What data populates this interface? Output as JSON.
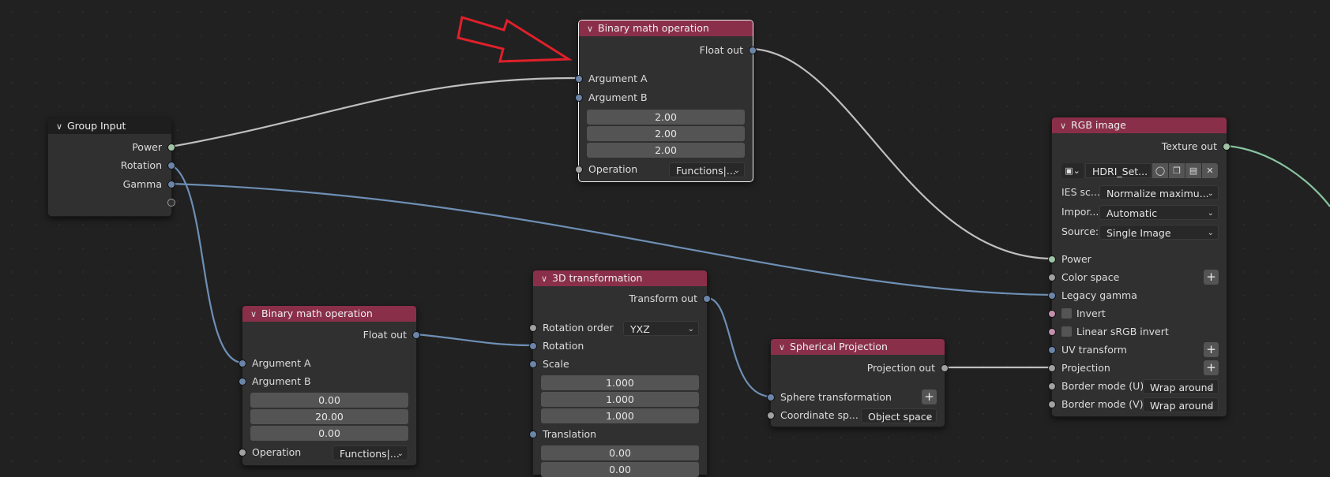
{
  "colors": {
    "header": "#8a2f4a",
    "socket_float": "#a1a1a1",
    "socket_vector": "#6b85a8",
    "socket_green": "#9ec4a4",
    "socket_pink": "#c290ad",
    "wire_gray": "#bfbfbf",
    "wire_blue": "#6e8fb5",
    "wire_green": "#88c4a0",
    "arrow": "#e0202a"
  },
  "group_input": {
    "title": "Group Input",
    "outputs": [
      "Power",
      "Rotation",
      "Gamma"
    ]
  },
  "math_top": {
    "title": "Binary math operation",
    "output": "Float out",
    "arg_a": "Argument A",
    "arg_b": "Argument B",
    "values": [
      "2.00",
      "2.00",
      "2.00"
    ],
    "op_label": "Operation",
    "op_value": "Functions|..."
  },
  "math_bottom": {
    "title": "Binary math operation",
    "output": "Float out",
    "arg_a": "Argument A",
    "arg_b": "Argument B",
    "values": [
      "0.00",
      "20.00",
      "0.00"
    ],
    "op_label": "Operation",
    "op_value": "Functions|..."
  },
  "transform3d": {
    "title": "3D transformation",
    "output": "Transform out",
    "rot_order_label": "Rotation order",
    "rot_order_value": "YXZ",
    "rotation": "Rotation",
    "scale": "Scale",
    "scale_values": [
      "1.000",
      "1.000",
      "1.000"
    ],
    "translation": "Translation",
    "translation_values": [
      "0.00",
      "0.00"
    ]
  },
  "spherical": {
    "title": "Spherical Projection",
    "output": "Projection out",
    "sphere_transform": "Sphere transformation",
    "coord_label": "Coordinate sp...",
    "coord_value": "Object space"
  },
  "rgb_image": {
    "title": "RGB image",
    "output": "Texture out",
    "image_name": "HDRI_Set...",
    "ies_label": "IES sc...",
    "ies_value": "Normalize maximu...",
    "import_label": "Impor...",
    "import_value": "Automatic",
    "source_label": "Source:",
    "source_value": "Single Image",
    "power": "Power",
    "color_space": "Color space",
    "legacy_gamma": "Legacy gamma",
    "invert": "Invert",
    "linear_invert": "Linear sRGB invert",
    "uv_transform": "UV transform",
    "projection": "Projection",
    "border_u_label": "Border mode (U)",
    "border_u_value": "Wrap around",
    "border_v_label": "Border mode (V)",
    "border_v_value": "Wrap around"
  }
}
